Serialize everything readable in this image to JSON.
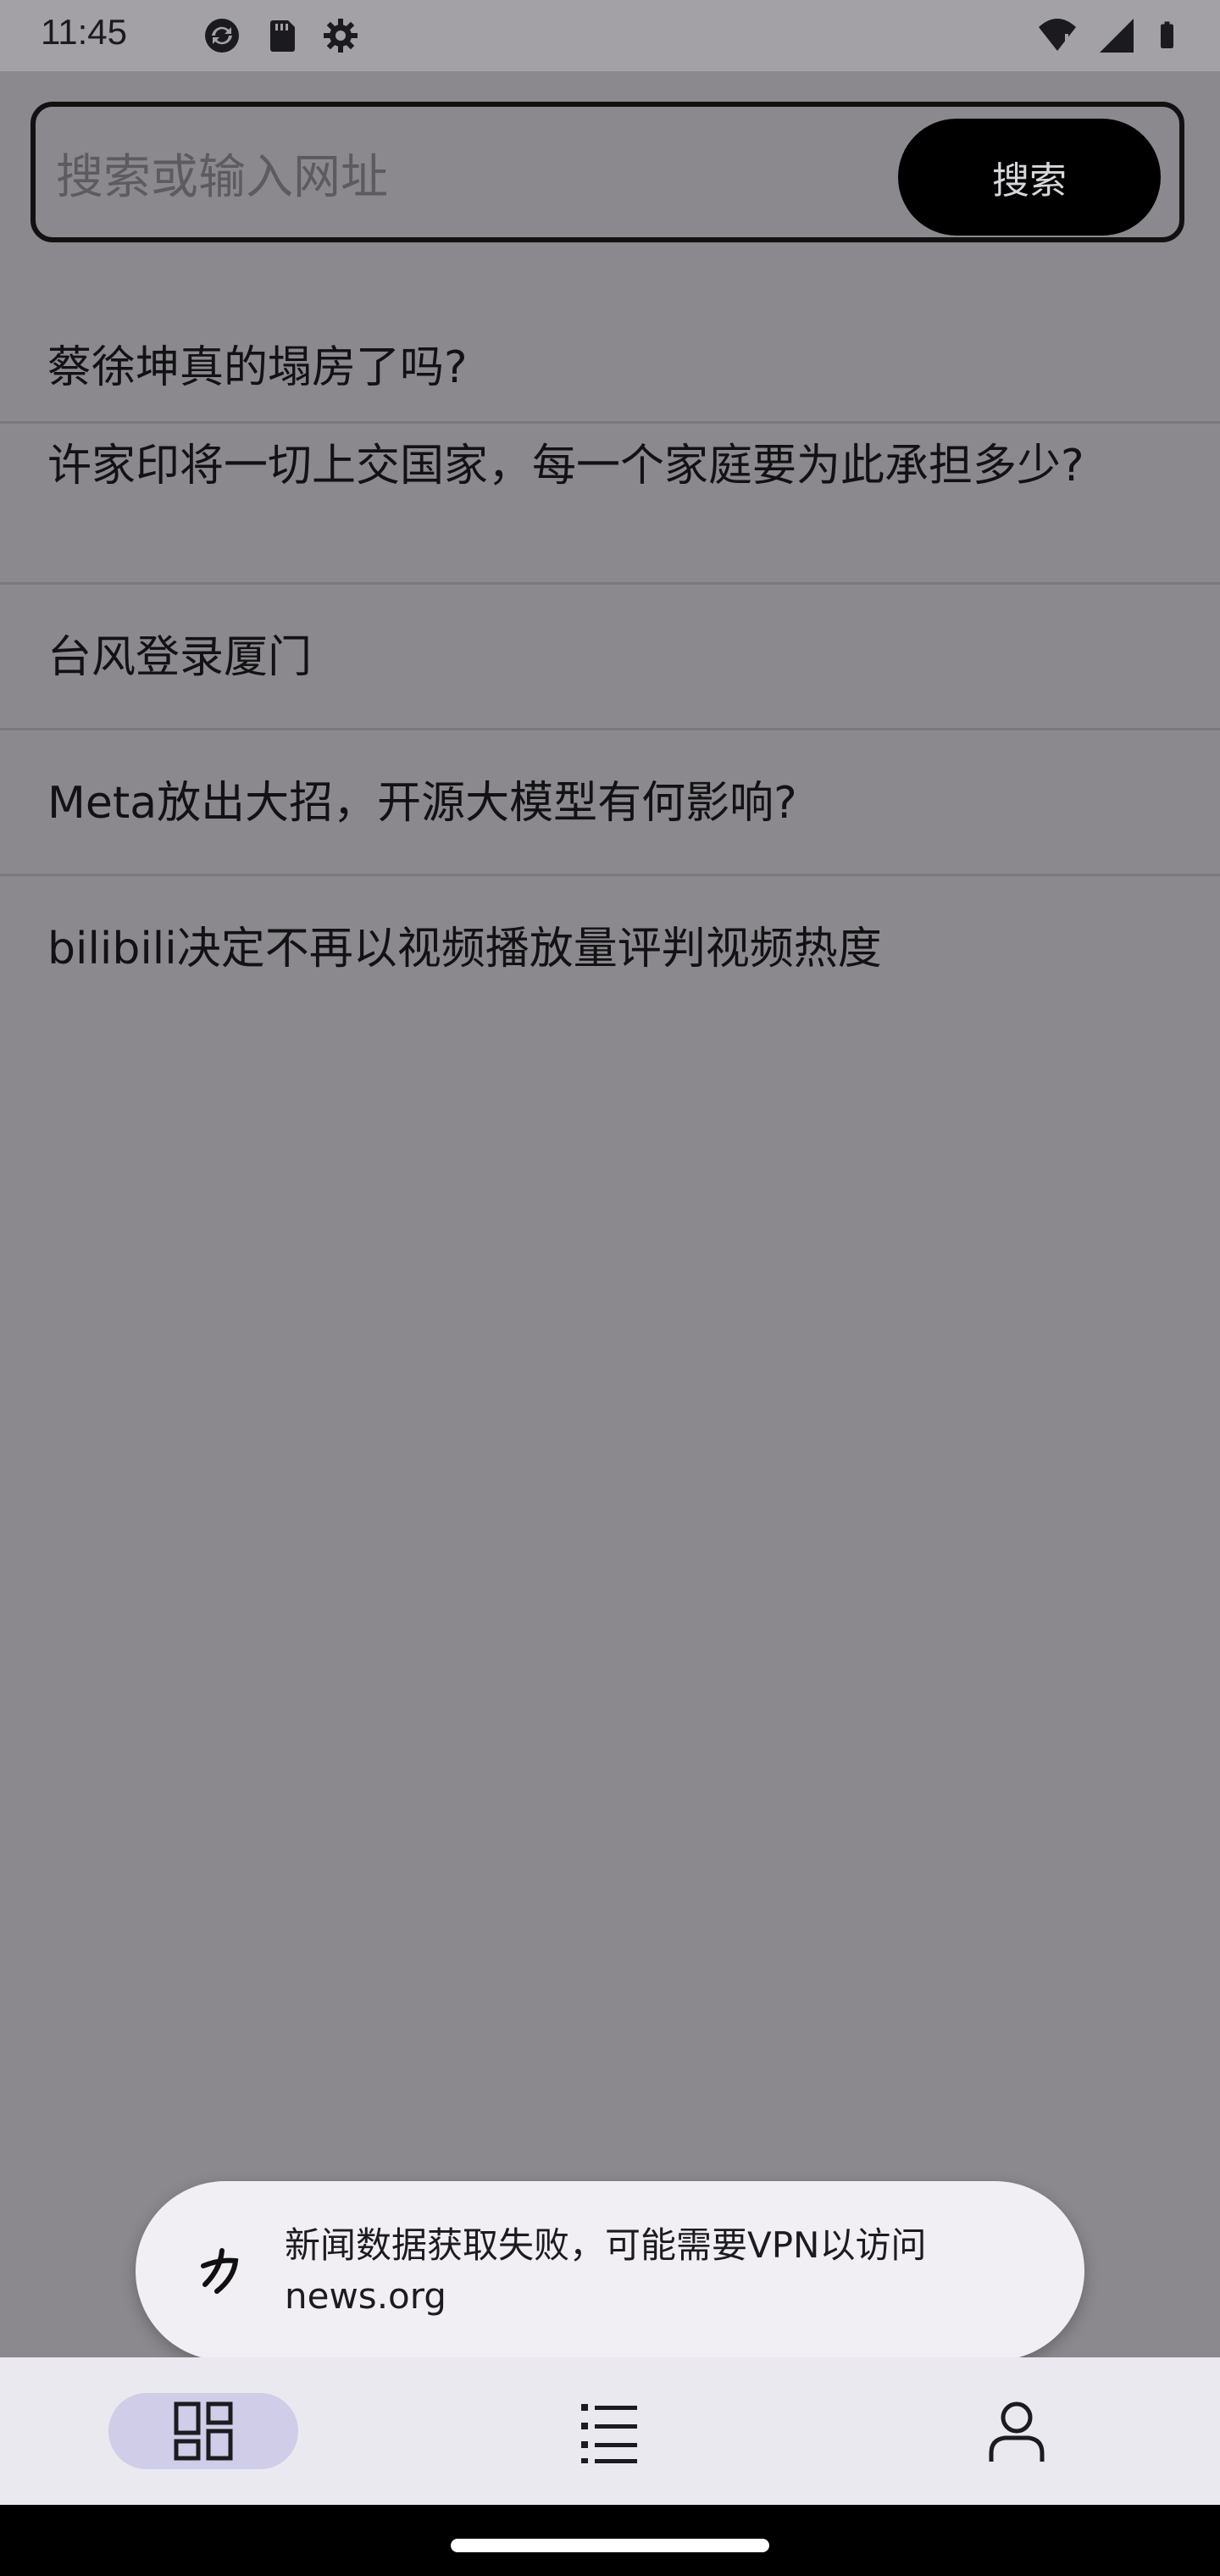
{
  "status_bar": {
    "time": "11:45",
    "left_icons": [
      "sync-icon",
      "sd-card-icon",
      "settings-gear-icon"
    ],
    "right_icons": [
      "wifi-icon",
      "cell-signal-icon",
      "battery-icon"
    ]
  },
  "search": {
    "placeholder": "搜索或输入网址",
    "value": "",
    "button_label": "搜索"
  },
  "news": [
    {
      "title": "蔡徐坤真的塌房了吗?"
    },
    {
      "title": "许家印将一切上交国家，每一个家庭要为此承担多少?"
    },
    {
      "title": "台风登录厦门"
    },
    {
      "title": "Meta放出大招，开源大模型有何影响?"
    },
    {
      "title": "bilibili决定不再以视频播放量评判视频热度"
    }
  ],
  "toast": {
    "message": "新闻数据获取失败，可能需要VPN以访问news.org",
    "icon": "app-logo-icon"
  },
  "bottom_nav": {
    "items": [
      {
        "name": "dashboard",
        "icon": "dashboard-icon",
        "selected": true
      },
      {
        "name": "list",
        "icon": "list-icon",
        "selected": false
      },
      {
        "name": "profile",
        "icon": "person-icon",
        "selected": false
      }
    ]
  },
  "colors": {
    "scrim_background": "#8b898d",
    "search_button_bg": "#000000",
    "toast_bg": "#f1eff3",
    "bottom_nav_bg": "#ebe9f0",
    "nav_selected_pill": "#cfcde8"
  }
}
